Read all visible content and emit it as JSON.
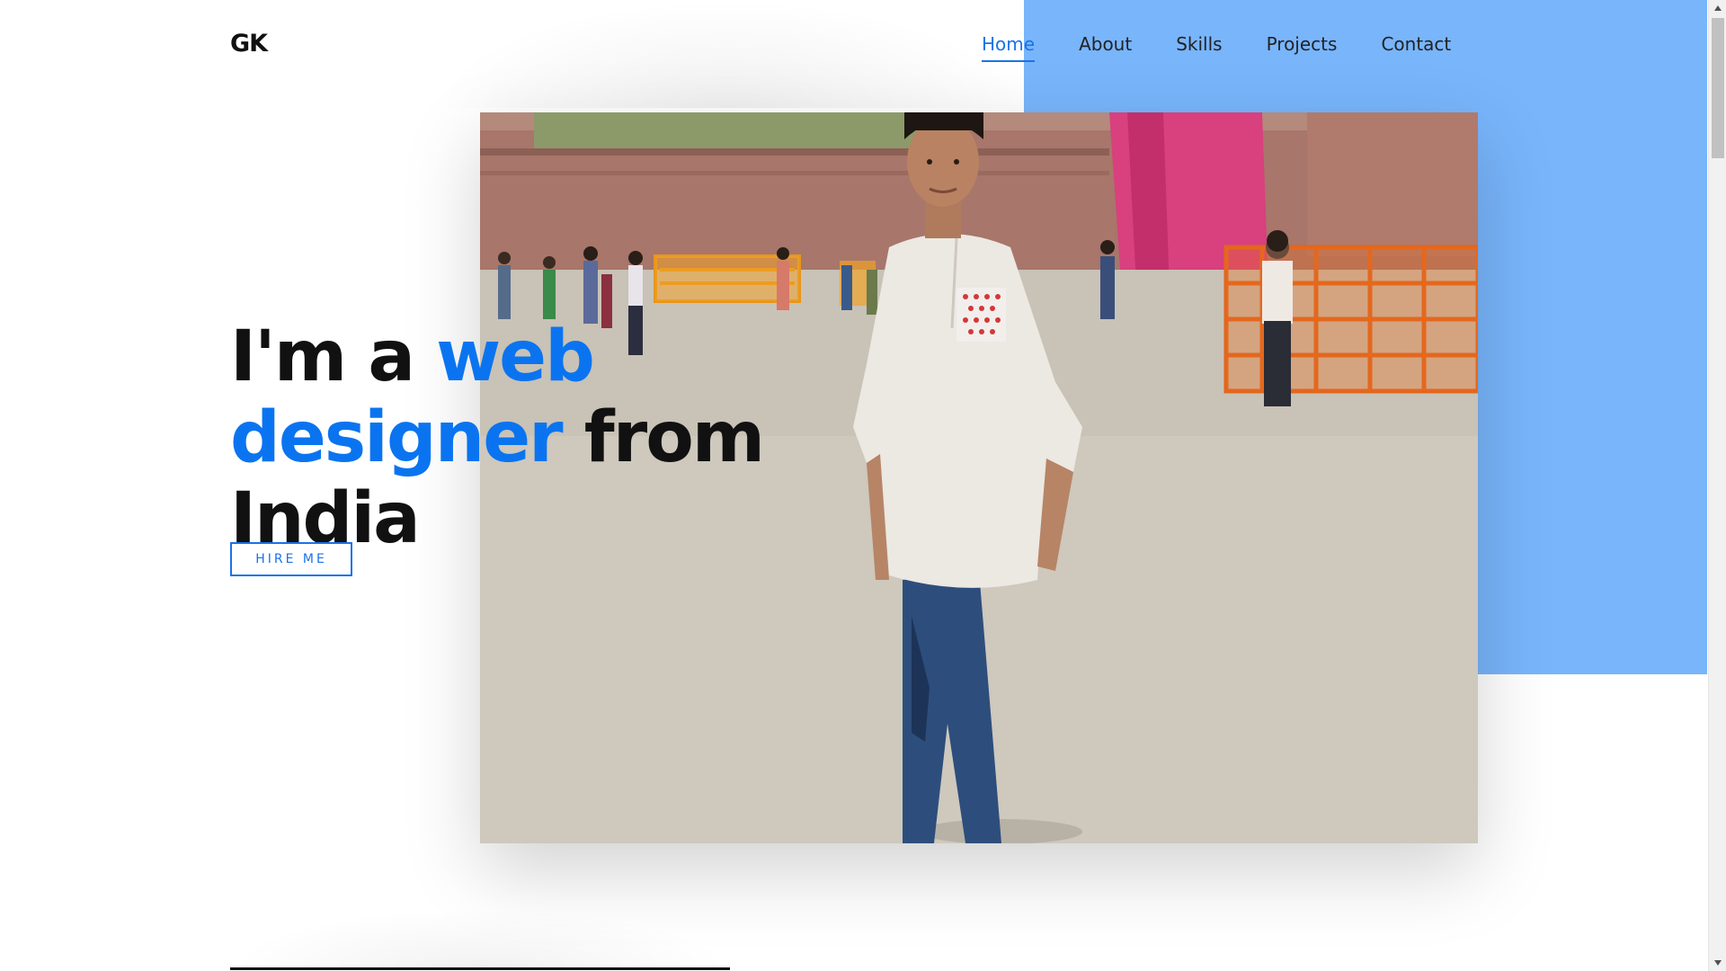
{
  "brand": {
    "logo_text": "GK"
  },
  "nav": {
    "items": [
      {
        "label": "Home",
        "active": true
      },
      {
        "label": "About",
        "active": false
      },
      {
        "label": "Skills",
        "active": false
      },
      {
        "label": "Projects",
        "active": false
      },
      {
        "label": "Contact",
        "active": false
      }
    ]
  },
  "hero": {
    "headline_part1": "I'm a ",
    "headline_accent": "web designer",
    "headline_part2": " from India",
    "cta_label": "HIRE ME"
  },
  "colors": {
    "accent": "#0a74f0",
    "panel_blue": "#78b5fb",
    "text_dark": "#111111"
  },
  "icons": {
    "scroll_up": "chevron-up-icon",
    "scroll_down": "chevron-down-icon"
  }
}
